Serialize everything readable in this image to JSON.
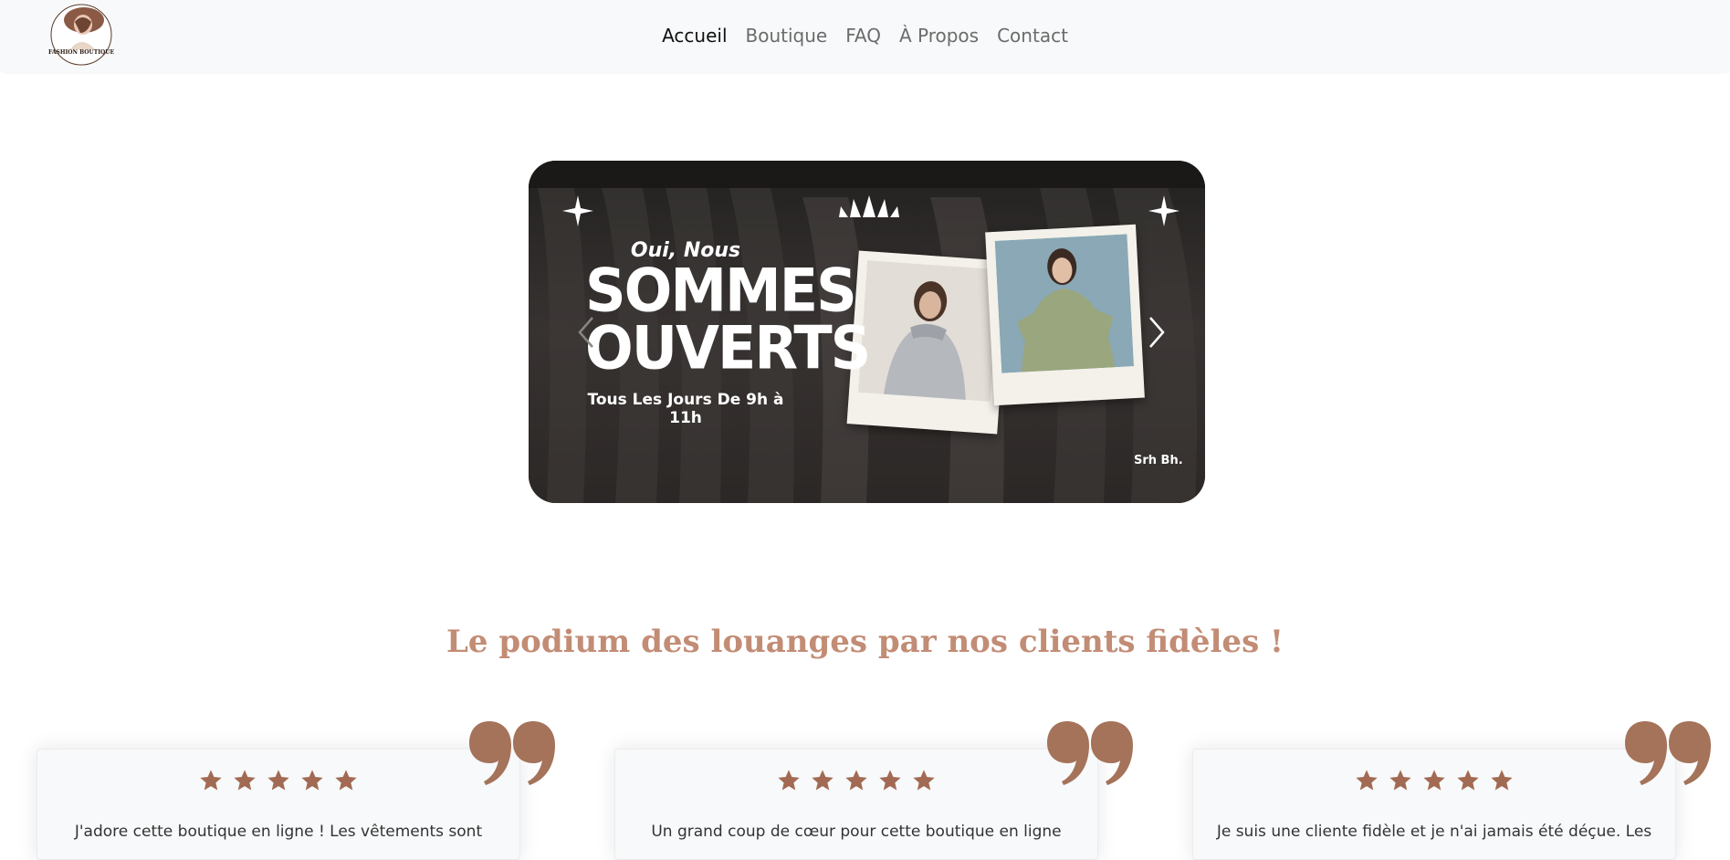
{
  "navbar": {
    "logo_text": "FASHION BOUTIQUE",
    "links": [
      "Accueil",
      "Boutique",
      "FAQ",
      "À Propos",
      "Contact"
    ],
    "active": "Accueil"
  },
  "carousel": {
    "line1": "Oui, Nous",
    "line2a": "SOMMES",
    "line2b": "OUVERTS",
    "line3": "Tous Les Jours De 9h à 11h",
    "credit": "Srh Bh."
  },
  "testimonials": {
    "title": "Le podium des louanges par nos clients fidèles !",
    "rating": 5,
    "items": [
      {
        "text": "J'adore cette boutique en ligne ! Les vêtements sont"
      },
      {
        "text": "Un grand coup de cœur pour cette boutique en ligne"
      },
      {
        "text": "Je suis une cliente fidèle et je n'ai jamais été déçue. Les"
      }
    ]
  },
  "colors": {
    "accent": "#c28c75",
    "star": "#a26a52",
    "quote": "#a4735a"
  }
}
